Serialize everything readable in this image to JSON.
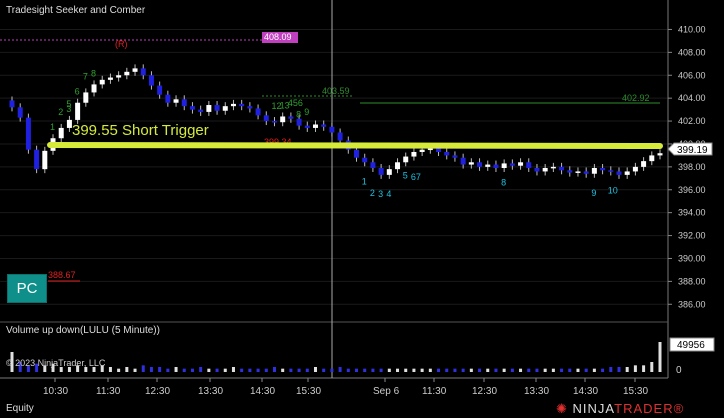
{
  "window": {
    "title": "Tradesight Seeker and Comber",
    "footer_label": "Equity",
    "logo_text_ninja": "NINJA",
    "logo_text_trader": "TRADER",
    "logo_reg": "®"
  },
  "annotations": {
    "short_trigger": "399.55 Short Trigger",
    "pc_badge": "PC",
    "level_408": "408.09",
    "level_402": "402.92",
    "level_403": "403.59",
    "level_399_red": "399.34",
    "level_388": "388.67",
    "r_marker": "(R)",
    "copyright": "© 2023 NinjaTrader, LLC"
  },
  "colors": {
    "background": "#000000",
    "trigger_line": "#d6ea3a",
    "magenta": "#c040c0",
    "green_level": "#2e8b2e",
    "red_level": "#e02020",
    "cyan_count": "#20c0e0",
    "green_count": "#2ea02e",
    "up_bar": "#ffffff",
    "down_bar": "#2020e0"
  },
  "chart_data": [
    {
      "type": "candlestick",
      "title": "",
      "y_axis_ticks": [
        "410.00",
        "408.00",
        "406.00",
        "404.00",
        "402.00",
        "400.00",
        "398.00",
        "396.00",
        "394.00",
        "392.00",
        "390.00",
        "388.00",
        "386.00"
      ],
      "ylim": [
        385.5,
        411.0
      ],
      "current_price": "399.19",
      "time_ticks": [
        "10:30",
        "11:30",
        "12:30",
        "13:30",
        "14:30",
        "15:30",
        "Sep 6",
        "11:30",
        "12:30",
        "13:30",
        "14:30",
        "15:30"
      ],
      "session_break": "Sep 6",
      "levels": [
        {
          "label": "408.09",
          "value": 408.09
        },
        {
          "label": "403.59",
          "value": 403.59
        },
        {
          "label": "402.92",
          "value": 402.92
        },
        {
          "label": "399.55 Short Trigger",
          "value": 399.55
        },
        {
          "label": "399.34",
          "value": 399.34
        },
        {
          "label": "388.67",
          "value": 388.67
        }
      ],
      "closes": [
        403.2,
        402.3,
        399.5,
        397.8,
        399.4,
        400.5,
        401.4,
        402.1,
        403.6,
        404.5,
        405.2,
        405.6,
        405.8,
        406.0,
        406.3,
        406.6,
        406.0,
        405.1,
        404.3,
        403.6,
        403.9,
        403.3,
        403.0,
        402.8,
        403.4,
        402.9,
        403.3,
        403.5,
        403.3,
        403.1,
        402.5,
        402.0,
        401.9,
        402.4,
        402.2,
        401.6,
        401.4,
        401.7,
        401.5,
        401.0,
        400.3,
        399.5,
        398.8,
        398.4,
        397.9,
        397.3,
        397.8,
        398.4,
        398.9,
        399.3,
        399.5,
        399.6,
        399.3,
        399.0,
        398.8,
        398.2,
        398.4,
        398.0,
        398.2,
        397.9,
        398.3,
        398.1,
        398.4,
        397.9,
        397.6,
        397.9,
        398.0,
        397.7,
        397.5,
        397.6,
        397.4,
        397.9,
        397.7,
        397.6,
        397.3,
        397.6,
        398.0,
        398.5,
        399.0,
        399.19
      ],
      "count_labels": [
        {
          "text": "1",
          "i": 5,
          "color": "green"
        },
        {
          "text": "2",
          "i": 6,
          "color": "green"
        },
        {
          "text": "3",
          "i": 7,
          "color": "green"
        },
        {
          "text": "5",
          "i": 7,
          "color": "green"
        },
        {
          "text": "6",
          "i": 8,
          "color": "green"
        },
        {
          "text": "7",
          "i": 9,
          "color": "green"
        },
        {
          "text": "8",
          "i": 10,
          "color": "green"
        },
        {
          "text": "12",
          "i": 32,
          "color": "green"
        },
        {
          "text": "13",
          "i": 33,
          "color": "green"
        },
        {
          "text": "456",
          "i": 34,
          "color": "green"
        },
        {
          "text": "8",
          "i": 35,
          "color": "green"
        },
        {
          "text": "9",
          "i": 36,
          "color": "green"
        },
        {
          "text": "1",
          "i": 43,
          "color": "cyan"
        },
        {
          "text": "2",
          "i": 44,
          "color": "cyan"
        },
        {
          "text": "3",
          "i": 45,
          "color": "cyan"
        },
        {
          "text": "4",
          "i": 46,
          "color": "cyan"
        },
        {
          "text": "5",
          "i": 48,
          "color": "cyan"
        },
        {
          "text": "67",
          "i": 49,
          "color": "cyan"
        },
        {
          "text": "8",
          "i": 60,
          "color": "cyan"
        },
        {
          "text": "9",
          "i": 71,
          "color": "cyan"
        },
        {
          "text": "10",
          "i": 73,
          "color": "cyan"
        }
      ]
    },
    {
      "type": "bar",
      "title": "Volume up down(LULU (5 Minute))",
      "y_axis_ticks": [
        "0"
      ],
      "current_value": "49956",
      "volumes": [
        12,
        6,
        4,
        5,
        4,
        5,
        3,
        3,
        4,
        3,
        3,
        4,
        3,
        2,
        3,
        2,
        4,
        3,
        3,
        2,
        3,
        2,
        2,
        3,
        2,
        2,
        2,
        3,
        2,
        2,
        2,
        2,
        3,
        2,
        2,
        2,
        2,
        3,
        2,
        2,
        3,
        2,
        2,
        2,
        2,
        2,
        2,
        2,
        2,
        2,
        2,
        2,
        2,
        2,
        2,
        2,
        2,
        2,
        2,
        2,
        2,
        2,
        2,
        2,
        2,
        2,
        2,
        2,
        2,
        2,
        2,
        2,
        2,
        3,
        3,
        3,
        4,
        4,
        6,
        18
      ]
    }
  ]
}
